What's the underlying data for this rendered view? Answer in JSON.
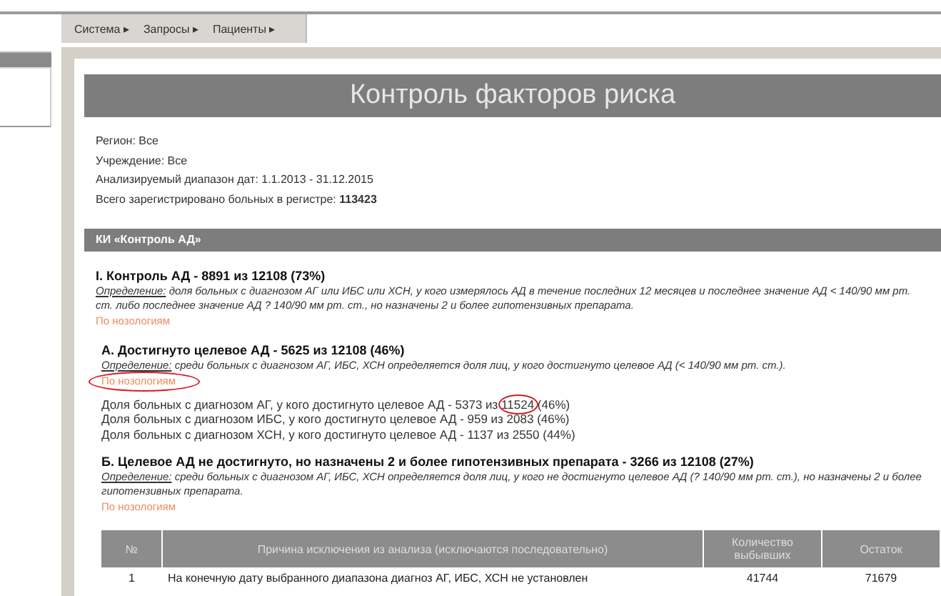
{
  "menu": [
    {
      "label": "Система ▸"
    },
    {
      "label": "Запросы ▸"
    },
    {
      "label": "Пациенты ▸"
    }
  ],
  "title": "Контроль факторов риска",
  "info": [
    {
      "text": "Регион: Все"
    },
    {
      "text": "Учреждение: Все"
    },
    {
      "text": "Анализируемый диапазон дат: 1.1.2013 - 31.12.2015"
    },
    {
      "text": "Всего зарегистрировано больных в регистре: **113423**"
    }
  ],
  "section_title": "КИ «Контроль АД»",
  "blocks": [
    {
      "heading": "I. Контроль АД - 8891 из 12108 (73%)",
      "definition_label": "Определение:",
      "definition": " доля больных с диагнозом АГ или ИБС или ХСН, у кого измерялось АД в течение последних 12 месяцев и последнее значение АД < 140/90 мм рт. ст. либо последнее значение АД ? 140/90 мм рт. ст., но назначены 2 и более гипотензивных препарата.",
      "link": "По нозологиям",
      "link_circled": false,
      "children": [
        {
          "heading": "А. Достигнуто целевое АД - 5625 из 12108 (46%)",
          "definition_label": "Определение:",
          "definition": " среди больных с диагнозом АГ, ИБС, ХСН определяется доля лиц, у кого достигнуто целевое АД (< 140/90 мм рт. ст.).",
          "link": "По нозологиям",
          "link_circled": true,
          "lines": [
            {
              "parts": [
                {
                  "text": "Доля больных с диагнозом АГ, у кого достигнуто целевое АД - 5373 из ",
                  "circled": false
                },
                {
                  "text": "11524",
                  "circled": true
                },
                {
                  "text": " (46%)",
                  "circled": false
                }
              ]
            },
            {
              "parts": [
                {
                  "text": "Доля больных с диагнозом ИБС, у кого достигнуто целевое АД - 959 из 2083 (46%)",
                  "circled": false
                }
              ]
            },
            {
              "parts": [
                {
                  "text": "Доля больных с диагнозом ХСН, у кого достигнуто целевое АД - 1137 из 2550 (44%)",
                  "circled": false
                }
              ]
            }
          ]
        },
        {
          "heading": "Б. Целевое АД не достигнуто, но назначены 2 и более гипотензивных препарата - 3266 из 12108 (27%)",
          "definition_label": "Определение:",
          "definition": " среди больных с диагнозом АГ, ИБС, ХСН определяется доля лиц, у кого не достигнуто целевое АД (? 140/90 мм рт. ст.), но назначены 2 и более гипотензивных препарата.",
          "link": "По нозологиям",
          "link_circled": false
        }
      ]
    }
  ],
  "table": {
    "columns": [
      "№",
      "Причина исключения из анализа (исключаются последовательно)",
      "Количество выбывших",
      "Остаток"
    ],
    "rows": [
      [
        "1",
        "На конечную дату выбранного диапазона диагноз АГ, ИБС, ХСН не установлен",
        "41744",
        "71679"
      ]
    ]
  }
}
